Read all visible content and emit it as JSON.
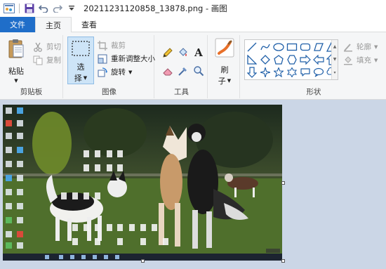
{
  "window": {
    "title": "20211231120858_13878.png - 画图"
  },
  "qat": {
    "app_icon": "paint-app-icon",
    "save_icon": "save-icon",
    "undo_icon": "undo-icon",
    "redo_icon": "redo-icon",
    "customize_icon": "customize-qat-icon"
  },
  "tabs": [
    {
      "label": "文件"
    },
    {
      "label": "主页"
    },
    {
      "label": "查看"
    }
  ],
  "ribbon": {
    "clipboard": {
      "label": "剪贴板",
      "paste": "粘贴",
      "cut": "剪切",
      "copy": "复制"
    },
    "image": {
      "label": "图像",
      "select": "选",
      "select2": "择",
      "crop": "裁剪",
      "resize": "重新调整大小",
      "rotate": "旋转"
    },
    "tools": {
      "label": "工具",
      "text_glyph": "A"
    },
    "brushes": {
      "label1": "刷",
      "label2": "子"
    },
    "shapes": {
      "label": "形状",
      "outline": "轮廓",
      "fill": "填充"
    }
  },
  "colors": {
    "file_tab": "#1f6ec9",
    "ribbon_bg": "#f5f6f7",
    "workspace_bg": "#cbd6e6",
    "select_highlight": "#cde4f7"
  }
}
